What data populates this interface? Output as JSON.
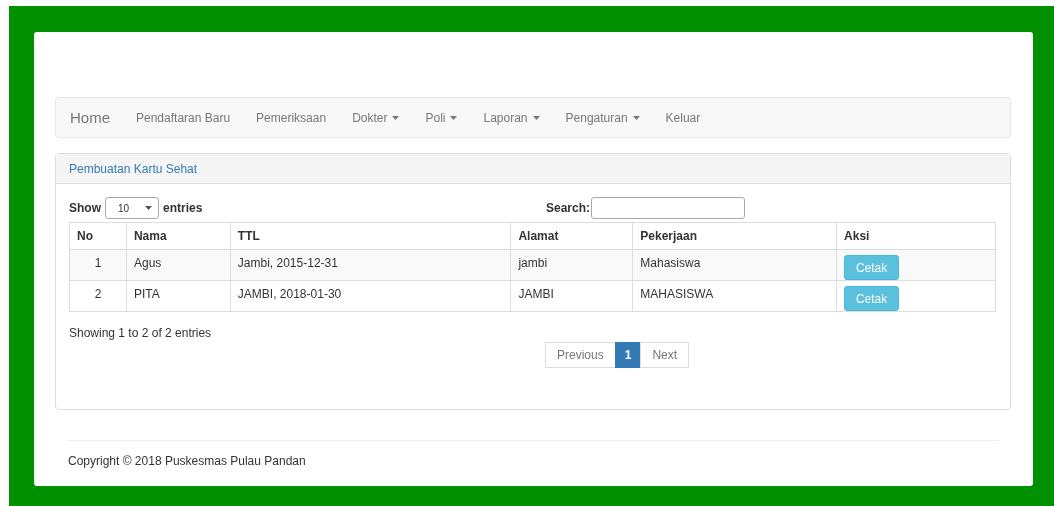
{
  "navbar": {
    "brand": "Home",
    "items": [
      {
        "label": "Pendaftaran Baru",
        "kind": "link"
      },
      {
        "label": "Pemeriksaan",
        "kind": "link"
      },
      {
        "label": "Dokter",
        "kind": "dropdown"
      },
      {
        "label": "Poli",
        "kind": "dropdown"
      },
      {
        "label": "Laporan",
        "kind": "dropdown"
      },
      {
        "label": "Pengaturan",
        "kind": "dropdown"
      },
      {
        "label": "Keluar",
        "kind": "link"
      }
    ]
  },
  "panel": {
    "title": "Pembuatan Kartu Sehat",
    "length": {
      "before": "Show",
      "value": "10",
      "after": "entries"
    },
    "search": {
      "label": "Search:"
    },
    "table": {
      "columns": [
        "No",
        "Nama",
        "TTL",
        "Alamat",
        "Pekerjaan",
        "Aksi"
      ],
      "rows": [
        {
          "cells": [
            "1",
            "Agus",
            "Jambi, 2015-12-31",
            "jambi",
            "Mahasiswa"
          ],
          "action": "Cetak"
        },
        {
          "cells": [
            "2",
            "PITA",
            "JAMBI, 2018-01-30",
            "JAMBI",
            "MAHASISWA"
          ],
          "action": "Cetak"
        }
      ]
    },
    "info": "Showing 1 to 2 of 2 entries",
    "pagination": [
      {
        "label": "Previous",
        "selected": false
      },
      {
        "label": "1",
        "selected": true
      },
      {
        "label": "Next",
        "selected": false
      }
    ]
  },
  "footer": "Copyright © 2018 Puskesmas Pulau Pandan"
}
